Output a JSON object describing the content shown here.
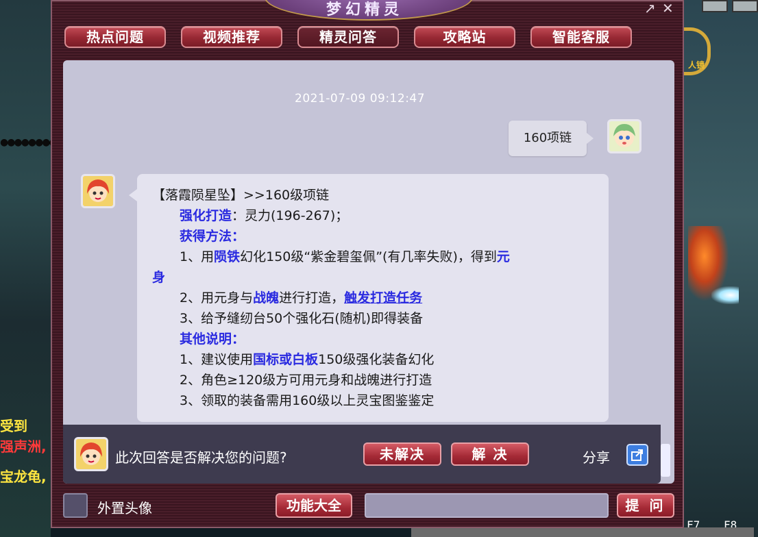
{
  "window": {
    "title": "梦幻精灵",
    "pin_icon": "↗",
    "close_icon": "✕"
  },
  "nav": {
    "tabs": [
      {
        "label": "热点问题"
      },
      {
        "label": "视频推荐"
      },
      {
        "label": "精灵问答"
      },
      {
        "label": "攻略站"
      },
      {
        "label": "智能客服"
      }
    ],
    "active_index": 2
  },
  "chat": {
    "timestamp": "2021-07-09 09:12:47",
    "user_message": "160项链",
    "answer": {
      "line1": {
        "title": "【落霞陨星坠】",
        "rest": ">>160级项链"
      },
      "enhance": {
        "label": "强化打造",
        "value": "：灵力(196-267)；"
      },
      "obtain_label": "获得方法：",
      "step1": {
        "a": "1、用",
        "b": "陨铁",
        "c": "幻化150级“紫金碧玺佩”(有几率失败)，得到",
        "d": "元",
        "e": "身"
      },
      "step2": {
        "a": "2、用元身与",
        "b": "战魄",
        "c": "进行打造，",
        "d": "触发打造任务"
      },
      "step3": "3、给予缝纫台50个强化石(随机)即得装备",
      "other_label": "其他说明：",
      "note1": {
        "a": "1、建议使用",
        "b": "国标或白板",
        "c": "150级强化装备幻化"
      },
      "note2": "2、角色≥120级方可用元身和战魄进行打造",
      "note3": "3、领取的装备需用160级以上灵宝图鉴鉴定"
    }
  },
  "feedback": {
    "question": "此次回答是否解决您的问题?",
    "unsolved_label": "未解决",
    "solved_label": "解 决",
    "share_label": "分享",
    "share_icon": "share-icon"
  },
  "bottom": {
    "avatar_toggle_label": "外置头像",
    "functions_label": "功能大全",
    "ask_input_value": "",
    "ask_label": "提 问"
  },
  "game": {
    "chat_lines": [
      "受到 ",
      "强声洲,",
      "宝龙龟,"
    ],
    "hud_text": "人镜",
    "fkeys": [
      "F7",
      "F8"
    ]
  },
  "colors": {
    "link_blue": "#2a2ae0",
    "button_red": "#a52a36",
    "panel_bg": "#c5c4d7",
    "bubble_bg": "#e4e3ef"
  }
}
